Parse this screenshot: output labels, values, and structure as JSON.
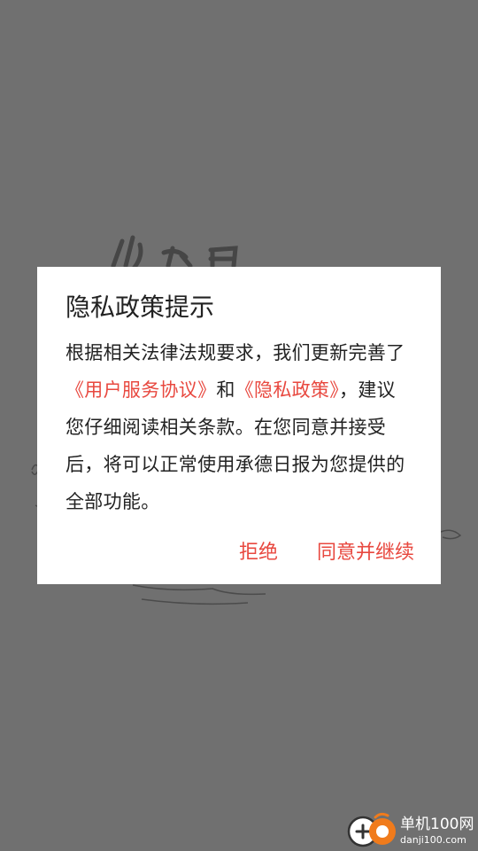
{
  "dialog": {
    "title": "隐私政策提示",
    "body_part1": "根据相关法律法规要求，我们更新完善了",
    "link_user_agreement": "《用户服务协议》",
    "conjunction": "和",
    "link_privacy_policy": "《隐私政策》",
    "body_part2": "，建议您仔细阅读相关条款。在您同意并接受后，将可以正常使用承德日报为您提供的全部功能。",
    "reject_label": "拒绝",
    "accept_label": "同意并继续"
  },
  "watermark": {
    "name": "单机100网",
    "domain": "danji100.com"
  },
  "colors": {
    "accent": "#e8483f",
    "overlay": "#505050",
    "text": "#222222"
  }
}
